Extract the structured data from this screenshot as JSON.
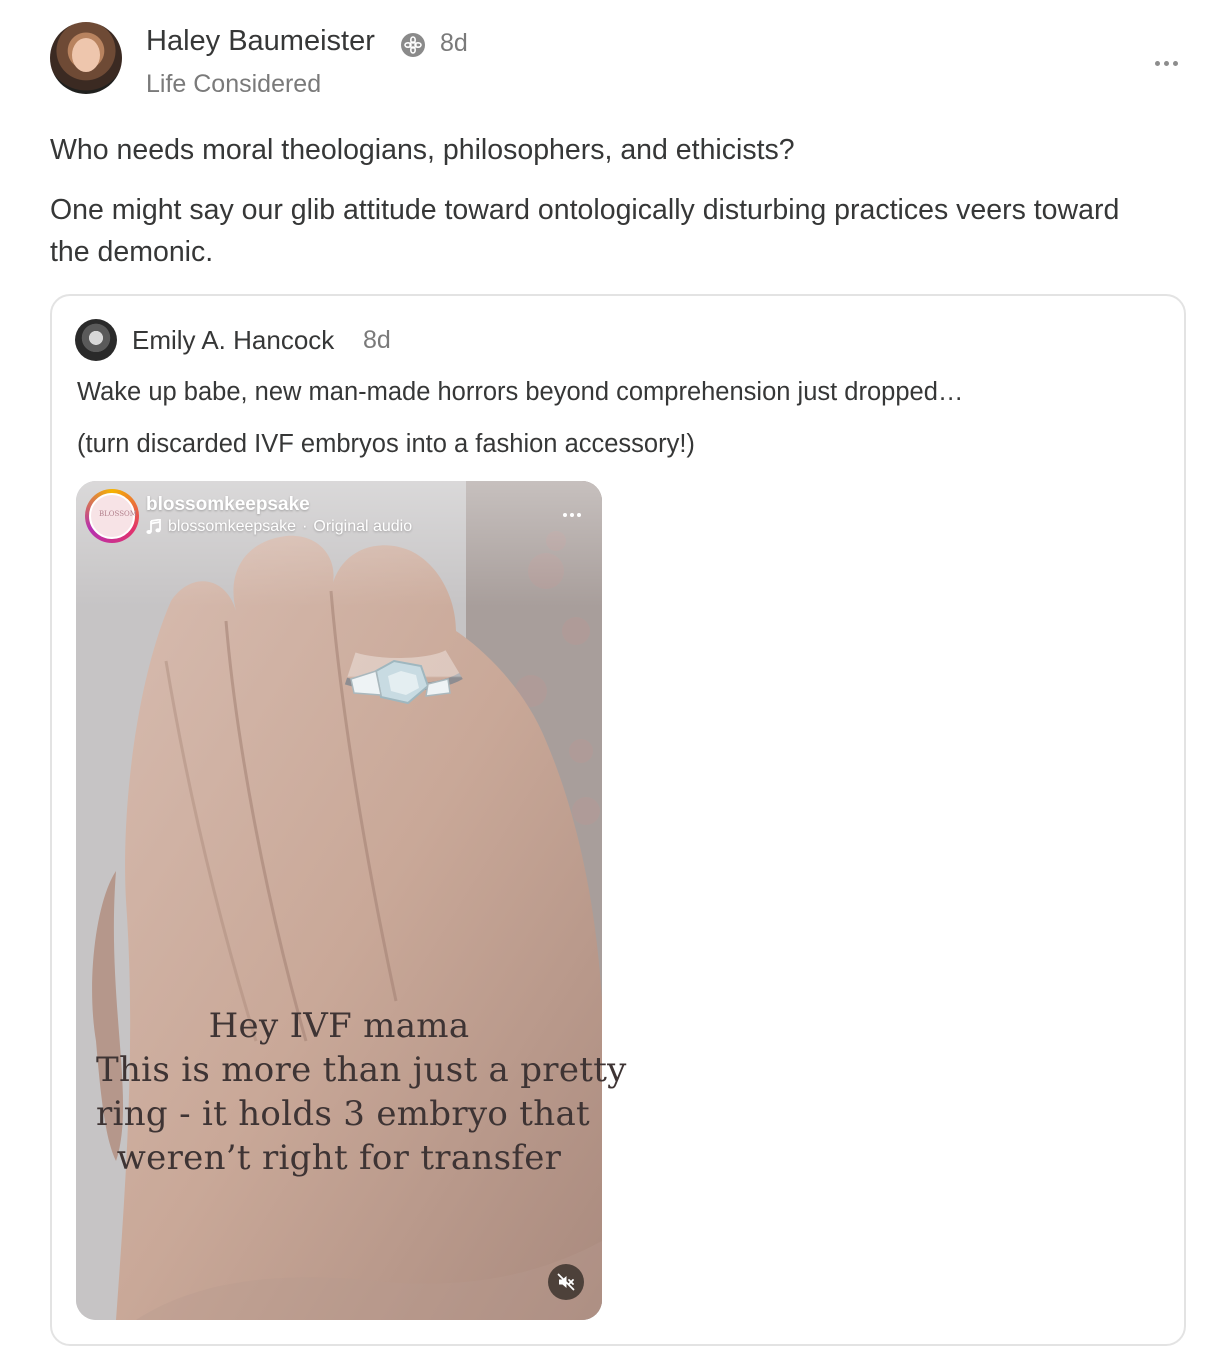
{
  "post": {
    "author_name": "Haley Baumeister",
    "age": "8d",
    "publication": "Life Considered",
    "paragraphs": [
      "Who needs moral theologians, philosophers, and ethicists?",
      "One might say our glib attitude toward ontologically disturbing practices veers toward the demonic."
    ]
  },
  "quote": {
    "author_name": "Emily A. Hancock",
    "age": "8d",
    "paragraphs": [
      "Wake up babe, new man-made horrors beyond comprehension just dropped…",
      "(turn discarded IVF embryos into a fashion accessory!)"
    ],
    "media": {
      "account_handle": "blossomkeepsake",
      "audio_account": "blossomkeepsake",
      "audio_separator": "·",
      "audio_label": "Original audio",
      "avatar_logo_text": "BLOSSOM",
      "overlay_lines": [
        "Hey IVF mama",
        "This is more than just a pretty",
        "ring - it holds 3 embryo that",
        "weren’t right for transfer"
      ]
    }
  },
  "icons": {
    "verified": "verified-badge-icon",
    "more": "more-dots-icon",
    "music": "music-note-icon",
    "mute": "muted-speaker-icon"
  },
  "colors": {
    "text": "#363737",
    "muted_text": "#7a7a7a",
    "card_border": "#e3e3e3"
  }
}
